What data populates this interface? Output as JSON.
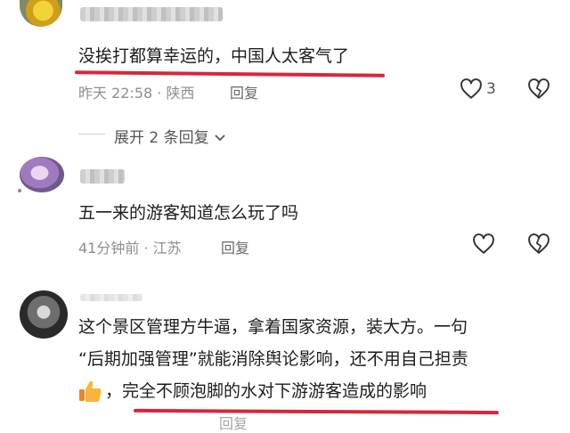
{
  "comments": [
    {
      "text": "没挨打都算幸运的，中国人太客气了",
      "time": "昨天 22:58",
      "location": "陕西",
      "reply_label": "回复",
      "like_count": "3",
      "like_icon": "heart-outline-icon",
      "dislike_icon": "broken-heart-icon"
    },
    {
      "text": "五一来的游客知道怎么玩了吗",
      "time": "41分钟前",
      "location": "江苏",
      "reply_label": "回复",
      "like_icon": "heart-outline-icon",
      "dislike_icon": "broken-heart-icon"
    },
    {
      "text_line1": "这个景区管理方牛逼，拿着国家资源，装大方。一句",
      "text_line2": "“后期加强管理”就能消除舆论影响，还不用自己担责",
      "text_line3": "，完全不顾泡脚的水对下游游客造成的影响",
      "emoji_icon": "thumbs-up-icon",
      "reply_label": "回复"
    }
  ],
  "expand_replies": "展开 2 条回复",
  "meta_separator": "·",
  "colors": {
    "underline": "#d8263a",
    "meta": "#8e8e8e"
  }
}
